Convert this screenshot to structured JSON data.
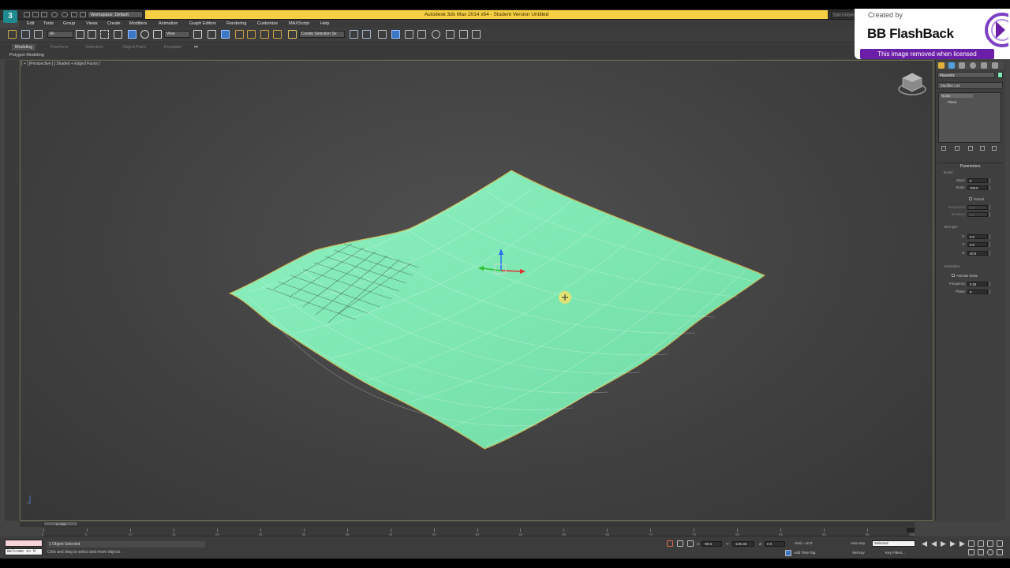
{
  "window": {
    "title": "Autodesk 3ds Max  2014 x64  -  Student Version   Untitled",
    "logo_letter": "3",
    "workspace": "Workspace: Default",
    "search_placeholder": "Type a keyword"
  },
  "menu": [
    "Edit",
    "Tools",
    "Group",
    "Views",
    "Create",
    "Modifiers",
    "Animation",
    "Graph Editors",
    "Rendering",
    "Customize",
    "MAXScript",
    "Help"
  ],
  "toolbar": {
    "selection_filter": "All",
    "ref_coord": "View",
    "named_selection": "Create Selection Se"
  },
  "ribbon": {
    "tabs": [
      "Modeling",
      "Freeform",
      "Selection",
      "Object Paint",
      "Populate"
    ],
    "active_tab": "Modeling",
    "subpanel": "Polygon Modeling"
  },
  "viewport": {
    "label": "[ + ] [Perspective ] [ Shaded + Edged Faces ]",
    "mesh_color": "#7fe8b3"
  },
  "command_panel": {
    "object_name": "Plane001",
    "object_color": "#7fe8b3",
    "modifier_list": "Modifier List",
    "stack": [
      "Noise",
      "Plane"
    ],
    "rollout": "Parameters",
    "noise_group": "Noise:",
    "seed_label": "Seed:",
    "seed_value": "0",
    "scale_label": "Scale:",
    "scale_value": "100.0",
    "fractal_label": "Fractal",
    "roughness_label": "Roughness:",
    "roughness_value": "0.0",
    "iterations_label": "Iterations:",
    "iterations_value": "6.0",
    "strength_group": "Strength:",
    "x_label": "X:",
    "x_value": "0.0",
    "y_label": "Y:",
    "y_value": "0.0",
    "z_label": "Z:",
    "z_value": "40.0",
    "animation_group": "Animation:",
    "animate_noise_label": "Animate Noise",
    "frequency_label": "Frequency:",
    "frequency_value": "0.25",
    "phase_label": "Phase:",
    "phase_value": "0"
  },
  "timeline": {
    "slider": "0 / 100",
    "ticks": [
      "0",
      "5",
      "10",
      "15",
      "20",
      "25",
      "30",
      "35",
      "40",
      "45",
      "50",
      "55",
      "60",
      "65",
      "70",
      "75",
      "80",
      "85",
      "90",
      "95",
      "100"
    ]
  },
  "status": {
    "maxscript_text": "Welcome to M",
    "selection": "1 Object Selected",
    "prompt": "Click and drag to select and move objects",
    "x_label": "X:",
    "x_value": "-88.5",
    "y_label": "Y:",
    "y_value": "-135.38",
    "z_label": "Z:",
    "z_value": "0.0",
    "grid": "Grid = 10.0",
    "add_time_tag": "Add Time Tag",
    "auto_key": "Auto Key",
    "set_key": "Set Key",
    "selected": "Selected",
    "key_filters": "Key Filters..."
  },
  "watermark": {
    "created_by": "Created by",
    "brand": "BB FlashBack",
    "notice": "This image removed when licensed"
  },
  "colors": {
    "title_accent": "#f6cf42",
    "watermark_bar": "#6b1fa8",
    "viewport_border": "#6a6a4a"
  }
}
